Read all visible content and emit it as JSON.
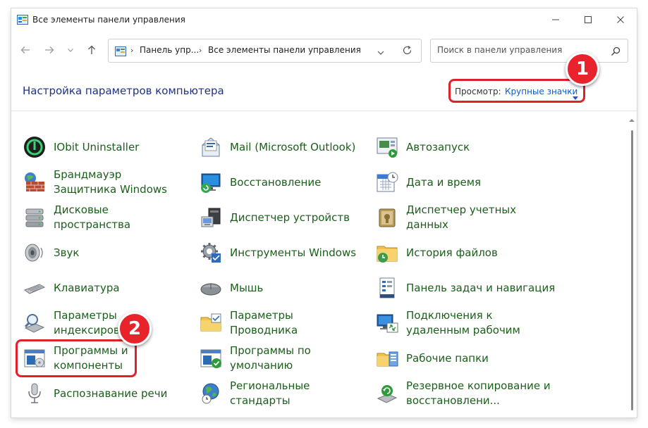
{
  "window": {
    "title": "Все элементы панели управления"
  },
  "address": {
    "crumbs": [
      "Панель упр...",
      "Все элементы панели управления"
    ]
  },
  "search": {
    "placeholder": "Поиск в панели управления"
  },
  "main": {
    "heading": "Настройка параметров компьютера",
    "view_label": "Просмотр:",
    "view_value": "Крупные значки"
  },
  "annotations": {
    "badge1": "1",
    "badge2": "2"
  },
  "items": [
    [
      "IObit Uninstaller",
      "Mail (Microsoft Outlook)",
      "Автозапуск"
    ],
    [
      "Брандмауэр Защитника Windows",
      "Восстановление",
      "Дата и время"
    ],
    [
      "Дисковые пространства",
      "Диспетчер устройств",
      "Диспетчер учетных данных"
    ],
    [
      "Звук",
      "Инструменты Windows",
      "История файлов"
    ],
    [
      "Клавиатура",
      "Мышь",
      "Панель задач и навигация"
    ],
    [
      "Параметры индексирова",
      "Параметры Проводника",
      "Подключения к удаленным рабочим"
    ],
    [
      "Программы и компоненты",
      "Программы по умолчанию",
      "Рабочие папки"
    ],
    [
      "Распознавание речи",
      "Региональные стандарты",
      "Резервное копирование и восстановлени..."
    ]
  ],
  "icons": [
    [
      "iobit-icon",
      "mail-icon",
      "autoplay-icon"
    ],
    [
      "firewall-icon",
      "recovery-icon",
      "datetime-icon"
    ],
    [
      "storage-spaces-icon",
      "device-manager-icon",
      "credential-manager-icon"
    ],
    [
      "speaker-icon",
      "windows-tools-icon",
      "file-history-icon"
    ],
    [
      "keyboard-icon",
      "mouse-icon",
      "taskbar-icon"
    ],
    [
      "indexing-icon",
      "explorer-options-icon",
      "remote-desktop-icon"
    ],
    [
      "programs-icon",
      "default-programs-icon",
      "work-folders-icon"
    ],
    [
      "microphone-icon",
      "region-icon",
      "backup-icon"
    ]
  ],
  "colors": {
    "link_green": "#1a5f1a",
    "heading_blue": "#1e3287",
    "highlight_red": "#e0202a"
  }
}
